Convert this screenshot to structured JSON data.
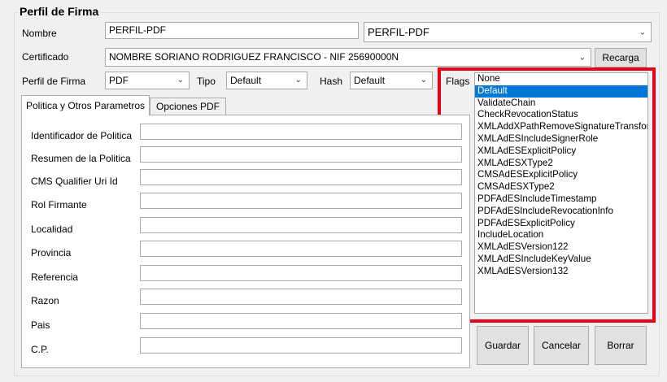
{
  "group": {
    "title": "Perfil de Firma"
  },
  "nombre": {
    "label": "Nombre",
    "value": "PERFIL-PDF",
    "combo_value": "PERFIL-PDF"
  },
  "certificado": {
    "label": "Certificado",
    "value": "NOMBRE SORIANO RODRIGUEZ FRANCISCO - NIF 25690000N",
    "reload_label": "Recarga"
  },
  "perfil": {
    "label": "Perfil de Firma",
    "value": "PDF"
  },
  "tipo": {
    "label": "Tipo",
    "value": "Default"
  },
  "hash": {
    "label": "Hash",
    "value": "Default"
  },
  "flags": {
    "label": "Flags",
    "selected": "Default",
    "items": [
      "None",
      "Default",
      "ValidateChain",
      "CheckRevocationStatus",
      "XMLAddXPathRemoveSignatureTransform",
      "XMLAdESIncludeSignerRole",
      "XMLAdESExplicitPolicy",
      "XMLAdESXType2",
      "CMSAdESExplicitPolicy",
      "CMSAdESXType2",
      "PDFAdESIncludeTimestamp",
      "PDFAdESIncludeRevocationInfo",
      "PDFAdESExplicitPolicy",
      "IncludeLocation",
      "XMLAdESVersion122",
      "XMLAdESIncludeKeyValue",
      "XMLAdESVersion132"
    ]
  },
  "tabs": [
    {
      "label": "Politica y Otros Parametros"
    },
    {
      "label": "Opciones PDF"
    }
  ],
  "fields": [
    {
      "label": "Identificador de Politica",
      "value": ""
    },
    {
      "label": "Resumen de la Politica",
      "value": ""
    },
    {
      "label": "CMS Qualifier Uri Id",
      "value": ""
    },
    {
      "label": "Rol Firmante",
      "value": ""
    },
    {
      "label": "Localidad",
      "value": ""
    },
    {
      "label": "Provincia",
      "value": ""
    },
    {
      "label": "Referencia",
      "value": ""
    },
    {
      "label": "Razon",
      "value": ""
    },
    {
      "label": "Pais",
      "value": ""
    },
    {
      "label": "C.P.",
      "value": ""
    }
  ],
  "buttons": {
    "save": "Guardar",
    "cancel": "Cancelar",
    "delete": "Borrar"
  },
  "colors": {
    "selection": "#0078d7",
    "highlight_box": "#e8001c"
  }
}
